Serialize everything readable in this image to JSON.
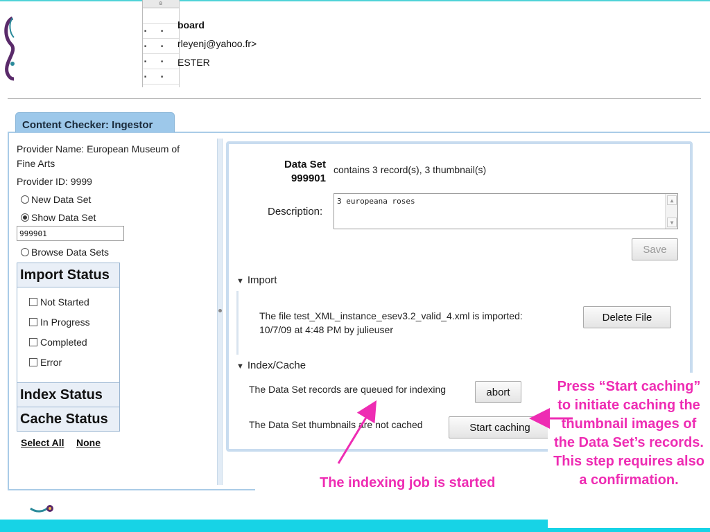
{
  "header": {
    "title_partial": "board",
    "email_partial": "rleyenj@yahoo.fr>",
    "role_partial": "ESTER"
  },
  "tab": {
    "label": "Content Checker: Ingestor"
  },
  "sidebar": {
    "provider_name": "Provider Name: European Museum of",
    "provider_name_cont": "Fine Arts",
    "provider_id": "Provider ID: 9999",
    "options": {
      "new_data_set": "New Data Set",
      "show_data_set": "Show Data Set",
      "browse_data_sets": "Browse Data Sets"
    },
    "selected_option": "show_data_set",
    "data_set_input": "999901",
    "import_status": {
      "title": "Import Status",
      "items": [
        "Not Started",
        "In Progress",
        "Completed",
        "Error"
      ]
    },
    "index_status": "Index Status",
    "cache_status": "Cache Status",
    "select_all": "Select All",
    "select_none": "None"
  },
  "dataset": {
    "label_line1": "Data Set",
    "label_line2": "999901",
    "contains": "contains 3 record(s), 3 thumbnail(s)",
    "description_label": "Description:",
    "description_value": "3 europeana roses",
    "save_label": "Save"
  },
  "import_section": {
    "title": "Import",
    "text_line1": "The file test_XML_instance_esev3.2_valid_4.xml is imported:",
    "text_line2": "10/7/09 at 4:48 PM by julieuser",
    "delete_label": "Delete File"
  },
  "index_section": {
    "title": "Index/Cache",
    "queued_text": "The Data Set records are queued for indexing",
    "abort_label": "abort",
    "cache_text": "The Data Set thumbnails are not cached",
    "start_caching_label": "Start caching"
  },
  "annotations": {
    "callout": "Press “Start caching” to initiate caching the thumbnail images of the Data Set’s records. This step requires also a confirmation.",
    "note": "The indexing job is started"
  },
  "colors": {
    "accent_pink": "#ee2cb3",
    "tab_blue": "#9dc8ea",
    "band_cyan": "#17d3e6"
  }
}
